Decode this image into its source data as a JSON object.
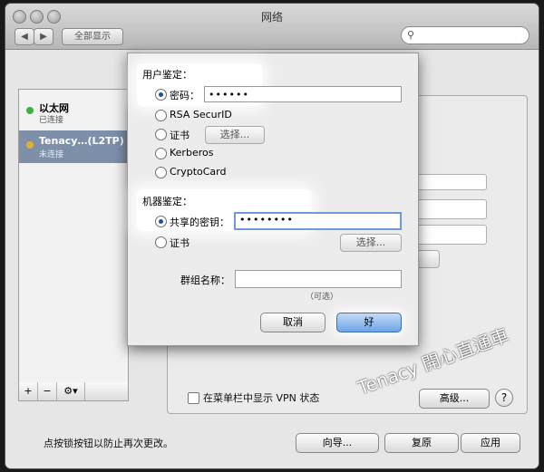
{
  "window": {
    "title": "网络",
    "nav": {
      "back": "◀",
      "forward": "▶",
      "show_all": "全部显示"
    },
    "search": {
      "placeholder": ""
    }
  },
  "sidebar": {
    "items": [
      {
        "name": "以太网",
        "status": "已连接",
        "dot_color": "#3db13d"
      },
      {
        "name": "Tenacy…(L2TP)",
        "status": "未连接",
        "dot_color": "#e0b12a"
      }
    ],
    "toolbar": {
      "add": "+",
      "remove": "−",
      "action": "⚙▾"
    }
  },
  "main": {
    "show_vpn_status_label": "在菜单栏中显示 VPN 状态",
    "advanced_button": "高级...",
    "help_button": "?"
  },
  "footer": {
    "lock_text": "点按锁按钮以防止再次更改。",
    "assist_button": "向导...",
    "revert_button": "复原",
    "apply_button": "应用"
  },
  "sheet": {
    "user_auth": {
      "heading": "用户鉴定：",
      "options": [
        {
          "label": "密码：",
          "selected": true,
          "value": "••••••"
        },
        {
          "label": "RSA SecurID",
          "selected": false
        },
        {
          "label": "证书",
          "selected": false,
          "button": "选择..."
        },
        {
          "label": "Kerberos",
          "selected": false
        },
        {
          "label": "CryptoCard",
          "selected": false
        }
      ]
    },
    "machine_auth": {
      "heading": "机器鉴定：",
      "options": [
        {
          "label": "共享的密钥：",
          "selected": true,
          "value": "••••••••"
        },
        {
          "label": "证书",
          "selected": false,
          "button": "选择..."
        }
      ],
      "group_name_label": "群组名称：",
      "group_name_value": "",
      "optional_hint": "（可选）"
    },
    "cancel_button": "取消",
    "ok_button": "好"
  },
  "watermark": "Tenacy 開心直通車",
  "colors": {
    "accent": "#6ea5e7",
    "selection": "#7d8fa9"
  }
}
